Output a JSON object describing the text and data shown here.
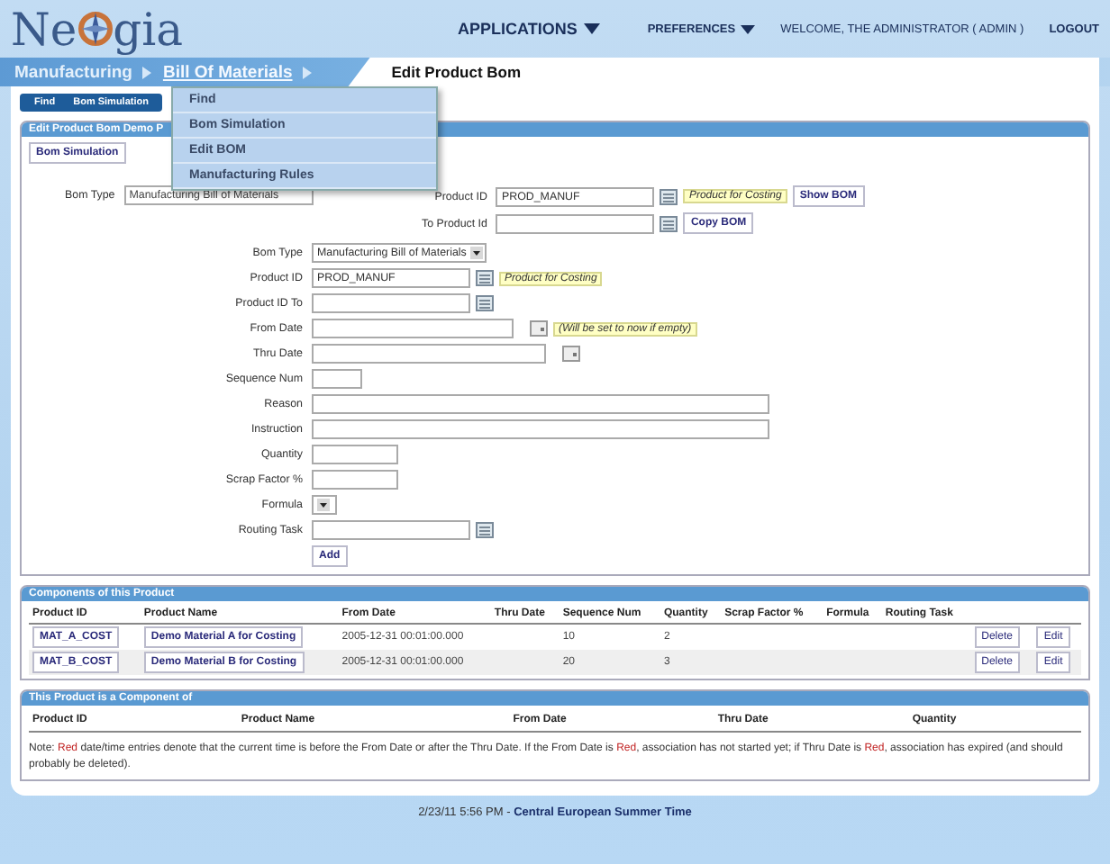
{
  "header": {
    "logo_start": "Ne",
    "logo_end": "gia",
    "applications": "APPLICATIONS",
    "preferences": "PREFERENCES",
    "welcome": "WELCOME, THE ADMINISTRATOR ( ADMIN )",
    "logout": "LOGOUT"
  },
  "breadcrumb": [
    {
      "label": "Manufacturing",
      "expanded": false
    },
    {
      "label": "Bill Of Materials",
      "expanded": true
    }
  ],
  "page_title": "Edit Product Bom",
  "menu": [
    "Find",
    "Bom Simulation",
    "Edit BOM",
    "Manufacturing Rules"
  ],
  "subtabs": [
    "Find",
    "Bom Simulation"
  ],
  "edit_section": {
    "title": "Edit Product Bom Demo P",
    "button": "Bom Simulation",
    "bom_type": {
      "label": "Bom Type",
      "value": "Manufacturing Bill of Materials"
    },
    "product_id": {
      "label": "Product ID",
      "value": "PROD_MANUF",
      "tag": "Product for Costing",
      "button": "Show BOM"
    },
    "to_product_id": {
      "label": "To Product Id",
      "button": "Copy BOM"
    },
    "fields": [
      {
        "label": "Bom Type",
        "kind": "select",
        "value": "Manufacturing Bill of Materials"
      },
      {
        "label": "Product ID",
        "kind": "lookup",
        "value": "PROD_MANUF",
        "tag": "Product for Costing"
      },
      {
        "label": "Product ID To",
        "kind": "lookup"
      },
      {
        "label": "From Date",
        "kind": "date",
        "tag": "(Will be set to now if empty)"
      },
      {
        "label": "Thru Date",
        "kind": "datewide"
      },
      {
        "label": "Sequence Num",
        "kind": "short"
      },
      {
        "label": "Reason",
        "kind": "long"
      },
      {
        "label": "Instruction",
        "kind": "long"
      },
      {
        "label": "Quantity",
        "kind": "medium"
      },
      {
        "label": "Scrap Factor %",
        "kind": "medium"
      },
      {
        "label": "Formula",
        "kind": "smallselect"
      },
      {
        "label": "Routing Task",
        "kind": "lookup"
      }
    ],
    "submit": "Add"
  },
  "components": {
    "title": "Components of this Product",
    "columns": [
      "Product ID",
      "Product Name",
      "From Date",
      "Thru Date",
      "Sequence Num",
      "Quantity",
      "Scrap Factor %",
      "Formula",
      "Routing Task"
    ],
    "rows": [
      {
        "product_id": "MAT_A_COST",
        "name": "Demo Material A for Costing",
        "from": "2005-12-31 00:01:00.000",
        "seq": "10",
        "qty": "2",
        "delete": "Delete",
        "edit": "Edit"
      },
      {
        "product_id": "MAT_B_COST",
        "name": "Demo Material B for Costing",
        "from": "2005-12-31 00:01:00.000",
        "seq": "20",
        "qty": "3",
        "delete": "Delete",
        "edit": "Edit"
      }
    ]
  },
  "component_of": {
    "title": "This Product is a Component of",
    "columns": [
      "Product ID",
      "Product Name",
      "From Date",
      "Thru Date",
      "Quantity"
    ],
    "note": [
      {
        "text": "Note: ",
        "red": false
      },
      {
        "text": "Red",
        "red": true
      },
      {
        "text": " date/time entries denote that the current time is before the From Date or after the Thru Date.  If the From Date is ",
        "red": false
      },
      {
        "text": "Red",
        "red": true
      },
      {
        "text": ", association has not started yet; if Thru Date is ",
        "red": false
      },
      {
        "text": "Red",
        "red": true
      },
      {
        "text": ", association has expired (and should probably be deleted).",
        "red": false
      }
    ]
  },
  "footer": "2/23/11 5:56 PM - **Central European Summer Time**"
}
